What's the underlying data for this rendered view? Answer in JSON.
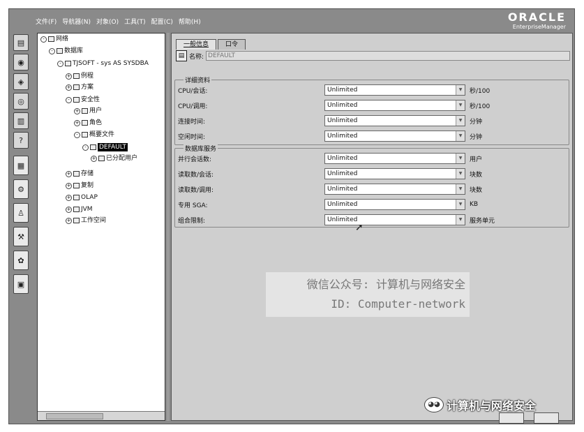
{
  "menu": [
    "文件(F)",
    "导航器(N)",
    "对象(O)",
    "工具(T)",
    "配置(C)",
    "帮助(H)"
  ],
  "logo": {
    "main": "ORACLE",
    "sub": "EnterpriseManager"
  },
  "toolbar_icons": [
    "document-icon",
    "database-icon",
    "cube-icon",
    "cluster-icon",
    "trash-icon",
    "help-icon"
  ],
  "tool_launchers": [
    "storage-tool-icon",
    "security-tool-icon",
    "schema-tool-icon",
    "instance-tool-icon",
    "network-tool-icon",
    "workspace-tool-icon"
  ],
  "tree": [
    {
      "label": "网络",
      "level": 0,
      "exp": "-"
    },
    {
      "label": "数据库",
      "level": 1,
      "exp": "-"
    },
    {
      "label": "TJSOFT - sys AS SYSDBA",
      "level": 2,
      "exp": "-"
    },
    {
      "label": "例程",
      "level": 3,
      "exp": "+"
    },
    {
      "label": "方案",
      "level": 3,
      "exp": "+"
    },
    {
      "label": "安全性",
      "level": 3,
      "exp": "-"
    },
    {
      "label": "用户",
      "level": 4,
      "exp": "+"
    },
    {
      "label": "角色",
      "level": 4,
      "exp": "+"
    },
    {
      "label": "概要文件",
      "level": 4,
      "exp": "-"
    },
    {
      "label": "DEFAULT",
      "level": 5,
      "exp": "-",
      "selected": true
    },
    {
      "label": "已分配用户",
      "level": 6,
      "exp": "+"
    },
    {
      "label": "存储",
      "level": 3,
      "exp": "+"
    },
    {
      "label": "复制",
      "level": 3,
      "exp": "+"
    },
    {
      "label": "OLAP",
      "level": 3,
      "exp": "+"
    },
    {
      "label": "JVM",
      "level": 3,
      "exp": "+"
    },
    {
      "label": "工作空间",
      "level": 3,
      "exp": "+"
    }
  ],
  "tabs": [
    "一般信息",
    "口令"
  ],
  "name_label": "名称:",
  "name_value": "DEFAULT",
  "group1": {
    "title": "详细资料",
    "rows": [
      {
        "label": "CPU/会话:",
        "value": "Unlimited",
        "unit": "秒/100"
      },
      {
        "label": "CPU/调用:",
        "value": "Unlimited",
        "unit": "秒/100"
      },
      {
        "label": "连接时间:",
        "value": "Unlimited",
        "unit": "分钟"
      },
      {
        "label": "空闲时间:",
        "value": "Unlimited",
        "unit": "分钟"
      }
    ]
  },
  "group2": {
    "title": "数据库服务",
    "rows": [
      {
        "label": "并行会话数:",
        "value": "Unlimited",
        "unit": "用户"
      },
      {
        "label": "读取数/会话:",
        "value": "Unlimited",
        "unit": "块数"
      },
      {
        "label": "读取数/调用:",
        "value": "Unlimited",
        "unit": "块数"
      },
      {
        "label": "专用 SGA:",
        "value": "Unlimited",
        "unit": "KB"
      },
      {
        "label": "组合限制:",
        "value": "Unlimited",
        "unit": "服务单元"
      }
    ]
  },
  "watermark": {
    "line1": "微信公众号: 计算机与网络安全",
    "line2": "ID: Computer-network"
  },
  "wechat_label": "计算机与网络安全"
}
